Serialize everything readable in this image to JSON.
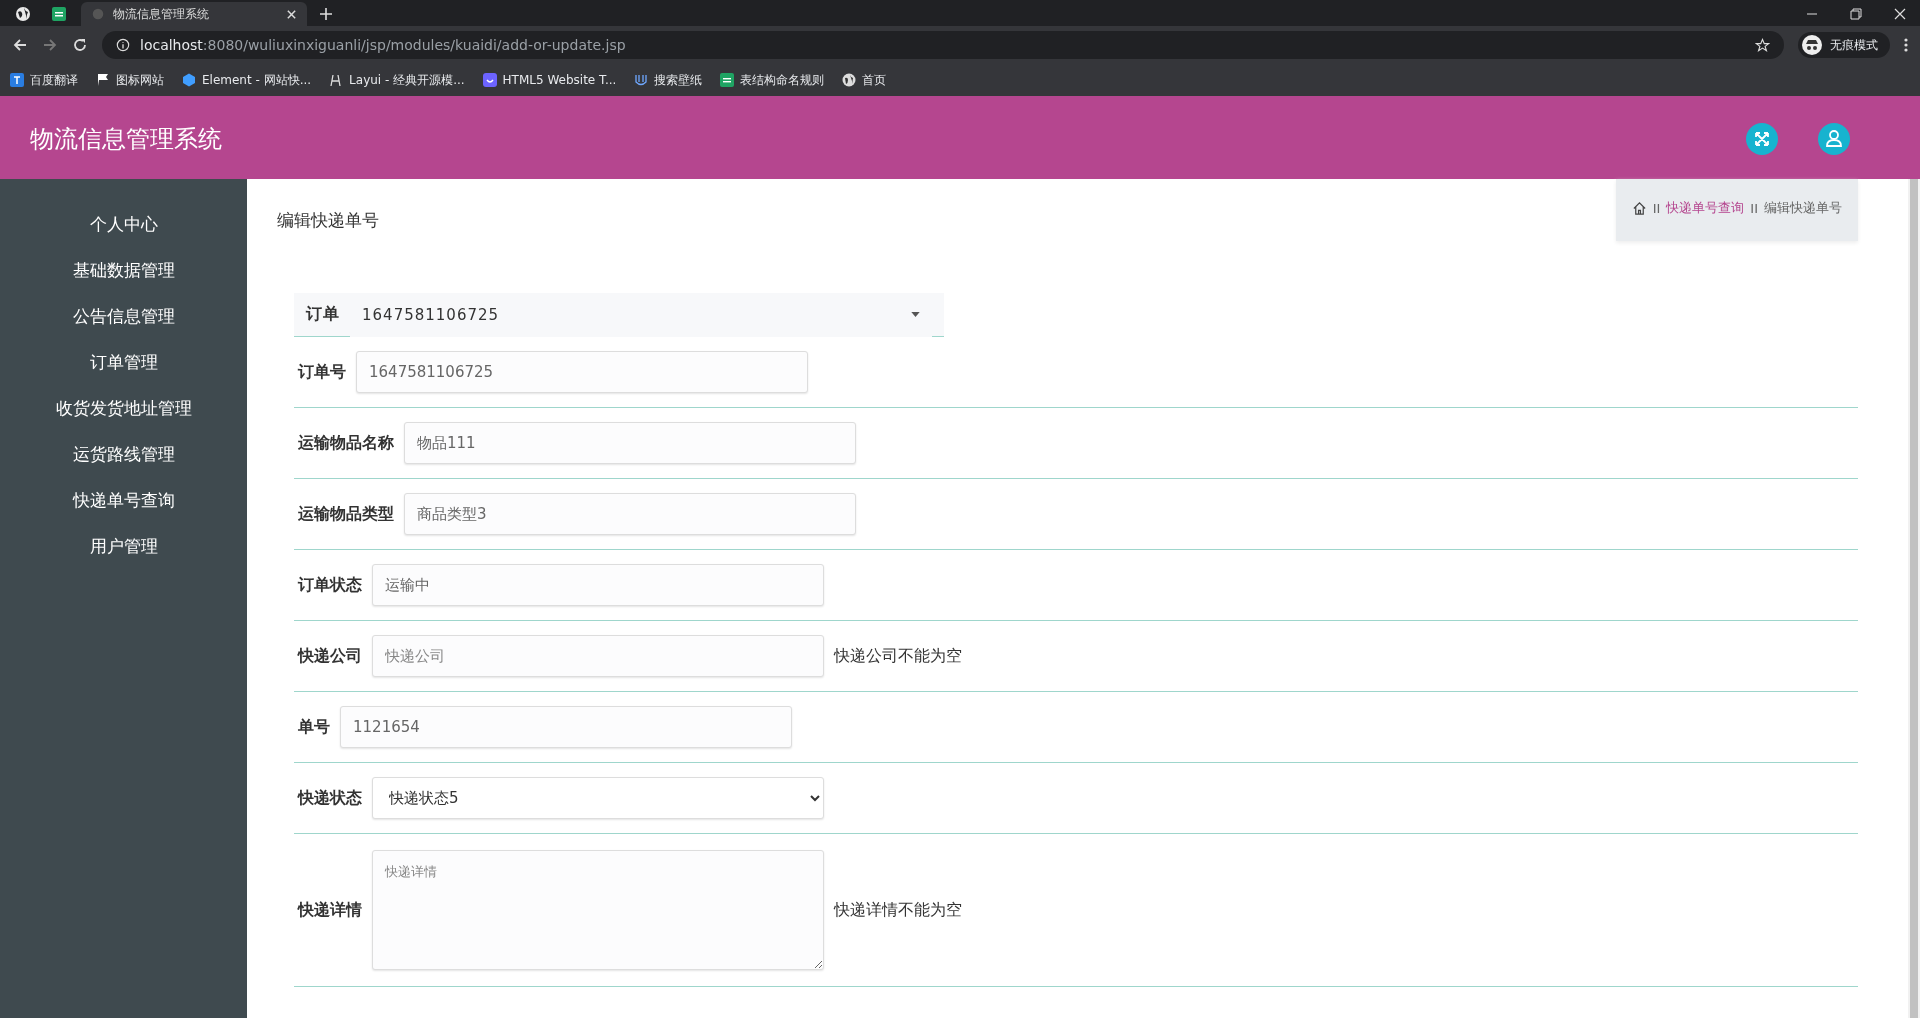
{
  "browser": {
    "tabs": [
      {
        "title": "物流信息管理系统",
        "selected": true
      }
    ],
    "url_host": "localhost",
    "url_path": ":8080/wuliuxinxiguanli/jsp/modules/kuaidi/add-or-update.jsp",
    "profile_label": "无痕模式",
    "bookmarks": [
      {
        "title": "百度翻译"
      },
      {
        "title": "图标网站"
      },
      {
        "title": "Element - 网站快..."
      },
      {
        "title": "Layui - 经典开源模..."
      },
      {
        "title": "HTML5 Website T..."
      },
      {
        "title": "搜索壁纸"
      },
      {
        "title": "表结构命名规则"
      },
      {
        "title": "首页"
      }
    ]
  },
  "app": {
    "title": "物流信息管理系统",
    "sidebar": {
      "items": [
        {
          "label": "个人中心"
        },
        {
          "label": "基础数据管理"
        },
        {
          "label": "公告信息管理"
        },
        {
          "label": "订单管理"
        },
        {
          "label": "收货发货地址管理"
        },
        {
          "label": "运货路线管理"
        },
        {
          "label": "快递单号查询"
        },
        {
          "label": "用户管理"
        }
      ]
    },
    "page_title": "编辑快递单号",
    "breadcrumb": [
      {
        "kind": "separator",
        "text": "II"
      },
      {
        "kind": "link",
        "text": "快递单号查询"
      },
      {
        "kind": "separator",
        "text": "II"
      },
      {
        "kind": "current",
        "text": "编辑快递单号"
      }
    ],
    "form": {
      "fields": [
        {
          "kind": "combo",
          "label": "订单",
          "value": "1647581106725"
        },
        {
          "kind": "input",
          "label": "订单号",
          "value": "1647581106725"
        },
        {
          "kind": "input",
          "label": "运输物品名称",
          "value": "物品111"
        },
        {
          "kind": "input",
          "label": "运输物品类型",
          "value": "商品类型3"
        },
        {
          "kind": "input",
          "label": "订单状态",
          "value": "运输中"
        },
        {
          "kind": "input",
          "label": "快递公司",
          "placeholder": "快递公司",
          "error": "快递公司不能为空"
        },
        {
          "kind": "input",
          "label": "单号",
          "value": "1121654"
        },
        {
          "kind": "select",
          "label": "快递状态",
          "value": "快递状态5"
        },
        {
          "kind": "textarea",
          "label": "快递详情",
          "placeholder": "快递详情",
          "error": "快递详情不能为空"
        }
      ]
    }
  }
}
